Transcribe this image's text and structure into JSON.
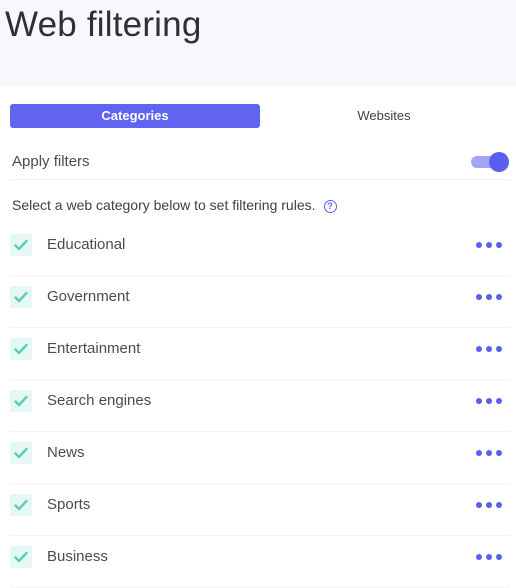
{
  "header": {
    "title": "Web filtering"
  },
  "tabs": [
    {
      "label": "Categories",
      "active": true
    },
    {
      "label": "Websites",
      "active": false
    }
  ],
  "apply_filters": {
    "label": "Apply filters",
    "enabled": true
  },
  "instruction": {
    "text": "Select a web category below to set filtering rules.",
    "help_icon": "question-circle-icon"
  },
  "categories": [
    {
      "label": "Educational",
      "checked": true
    },
    {
      "label": "Government",
      "checked": true
    },
    {
      "label": "Entertainment",
      "checked": true
    },
    {
      "label": "Search engines",
      "checked": true
    },
    {
      "label": "News",
      "checked": true
    },
    {
      "label": "Sports",
      "checked": true
    },
    {
      "label": "Business",
      "checked": true
    }
  ],
  "colors": {
    "accent": "#5b5ff0",
    "check": "#5ccfb0",
    "check_bg": "#e6f8f3",
    "header_bg": "#f7f7fc"
  }
}
